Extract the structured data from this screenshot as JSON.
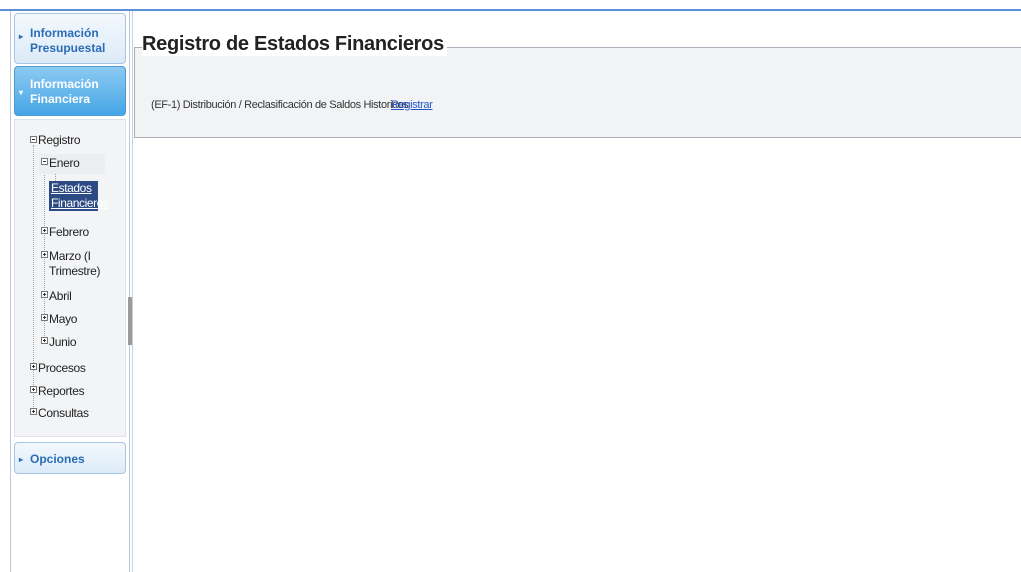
{
  "sidebar": {
    "sections": [
      {
        "label_line1": "Información",
        "label_line2": "Presupuestal",
        "state": "collapsed"
      },
      {
        "label_line1": "Información",
        "label_line2": "Financiera",
        "state": "expanded"
      },
      {
        "label_line1": "Opciones",
        "state": "collapsed"
      }
    ],
    "tree": {
      "registro": "Registro",
      "enero": "Enero",
      "estados_line1": "Estados",
      "estados_line2": "Financieros",
      "febrero": "Febrero",
      "marzo_line1": "Marzo (I",
      "marzo_line2": "Trimestre)",
      "abril": "Abril",
      "mayo": "Mayo",
      "junio": "Junio",
      "procesos": "Procesos",
      "reportes": "Reportes",
      "consultas": "Consultas"
    }
  },
  "main": {
    "title": "Registro de Estados Financieros",
    "row_label": "(EF-1) Distribución / Reclasificación de Saldos Historicos",
    "row_link": "Registrar"
  },
  "colors": {
    "accent": "#5b8fd6",
    "active_header": "#45a6e6",
    "selected_node": "#2c4b84",
    "link": "#2255cc"
  }
}
